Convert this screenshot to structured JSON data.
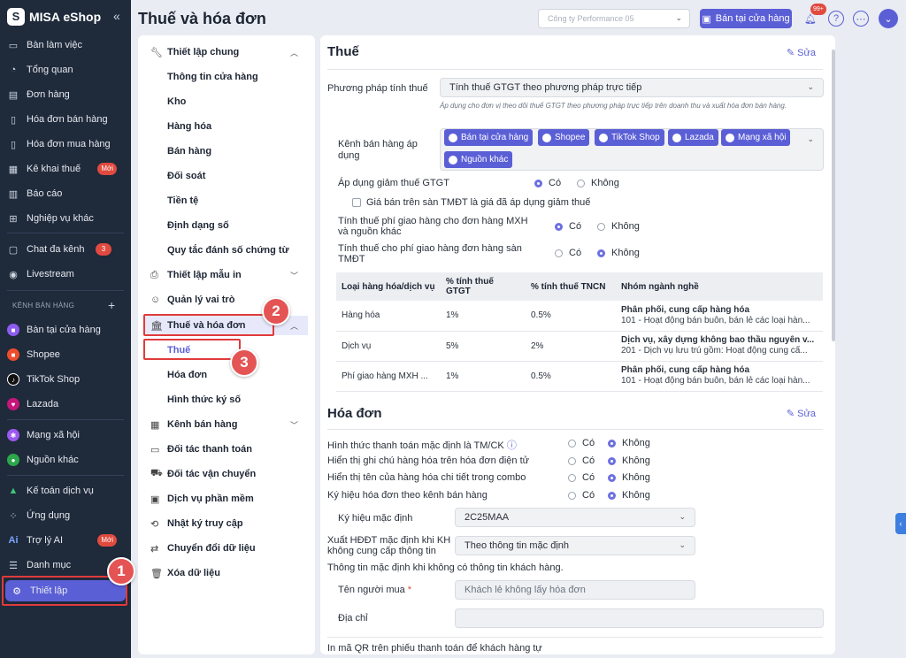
{
  "app": {
    "name": "MISA eShop",
    "page_title": "Thuế và hóa đơn",
    "company": "Công ty Performance 05"
  },
  "sidebar": {
    "items": [
      {
        "label": "Bàn làm việc",
        "icon": "monitor-icon"
      },
      {
        "label": "Tổng quan",
        "icon": "gauge-icon"
      },
      {
        "label": "Đơn hàng",
        "icon": "order-icon"
      },
      {
        "label": "Hóa đơn bán hàng",
        "icon": "invoice-icon"
      },
      {
        "label": "Hóa đơn mua hàng",
        "icon": "invoice-icon"
      },
      {
        "label": "Kê khai thuế",
        "icon": "tax-icon",
        "badge": "Mới"
      },
      {
        "label": "Báo cáo",
        "icon": "chart-icon"
      },
      {
        "label": "Nghiệp vụ khác",
        "icon": "grid-icon"
      }
    ],
    "items2": [
      {
        "label": "Chat đa kênh",
        "icon": "chat-icon",
        "badge": "3"
      },
      {
        "label": "Livestream",
        "icon": "live-icon"
      }
    ],
    "section_label": "KÊNH BÁN HÀNG",
    "channels": [
      {
        "label": "Bàn tại cửa hàng",
        "color": "#8e5cf0"
      },
      {
        "label": "Shopee",
        "color": "#ee4d2d"
      },
      {
        "label": "TikTok Shop",
        "color": "#111111"
      },
      {
        "label": "Lazada",
        "color": "#c7167a"
      }
    ],
    "channels2": [
      {
        "label": "Mạng xã hội",
        "color": "#9b59f0"
      },
      {
        "label": "Nguồn khác",
        "color": "#2aa84a"
      }
    ],
    "bottom": [
      {
        "label": "Kế toán dịch vụ",
        "icon": "accounting-icon"
      },
      {
        "label": "Ứng dụng",
        "icon": "apps-icon"
      },
      {
        "label": "Trợ lý AI",
        "icon": "ai-icon",
        "badge": "Mới"
      },
      {
        "label": "Danh mục",
        "icon": "list-icon"
      },
      {
        "label": "Thiết lập",
        "icon": "gear-icon"
      }
    ]
  },
  "topbar": {
    "sell_button": "Bán tại cửa hàng",
    "bell_badge": "99+"
  },
  "menu": {
    "general": "Thiết lập chung",
    "general_items": [
      "Thông tin cửa hàng",
      "Kho",
      "Hàng hóa",
      "Bán hàng",
      "Đối soát",
      "Tiền tệ",
      "Định dạng số",
      "Quy tắc đánh số chứng từ"
    ],
    "print": "Thiết lập mẫu in",
    "roles": "Quản lý vai trò",
    "tax": "Thuế và hóa đơn",
    "tax_items": [
      "Thuế",
      "Hóa đơn",
      "Hình thức ký số"
    ],
    "channels": "Kênh bán hàng",
    "payment": "Đối tác thanh toán",
    "shipping": "Đối tác vận chuyển",
    "software": "Dịch vụ phần mềm",
    "log": "Nhật ký truy cập",
    "convert": "Chuyển đổi dữ liệu",
    "delete": "Xóa dữ liệu"
  },
  "tax": {
    "title": "Thuế",
    "edit": "Sửa",
    "method_label": "Phương pháp tính thuế",
    "method_value": "Tính thuế GTGT theo phương pháp trực tiếp",
    "method_hint": "Áp dụng cho đơn vị theo dõi thuế GTGT theo phương pháp trực tiếp trên doanh thu và xuất hóa đơn bán hàng.",
    "channels_label": "Kênh bán hàng áp dụng",
    "channels": [
      "Bán tại cửa hàng",
      "Shopee",
      "TikTok Shop",
      "Lazada",
      "Mạng xã hội",
      "Nguồn khác"
    ],
    "vat_reduce_label": "Áp dụng giảm thuế GTGT",
    "yes": "Có",
    "no": "Không",
    "price_note": "Giá bán trên sàn TMĐT là giá đã áp dụng giảm thuế",
    "ship_mxh_label": "Tính thuế phí giao hàng cho đơn hàng MXH và nguồn khác",
    "ship_tmdt_label": "Tính thuế cho phí giao hàng đơn hàng sàn TMĐT",
    "table": {
      "headers": [
        "Loại hàng hóa/dịch vụ",
        "% tính thuế GTGT",
        "% tính thuế TNCN",
        "Nhóm ngành nghề"
      ],
      "rows": [
        {
          "type": "Hàng hóa",
          "vat": "1%",
          "pit": "0.5%",
          "group": "Phân phối, cung cấp hàng hóa",
          "desc": "101 - Hoạt động bán buôn, bán lẻ các loại hàn..."
        },
        {
          "type": "Dịch vụ",
          "vat": "5%",
          "pit": "2%",
          "group": "Dịch vụ, xây dựng không bao thầu nguyên v...",
          "desc": "201 - Dịch vụ lưu trú gồm: Hoạt động cung cấ..."
        },
        {
          "type": "Phí giao hàng MXH ...",
          "vat": "1%",
          "pit": "0.5%",
          "group": "Phân phối, cung cấp hàng hóa",
          "desc": "101 - Hoạt động bán buôn, bán lẻ các loại hàn..."
        }
      ]
    }
  },
  "invoice": {
    "title": "Hóa đơn",
    "edit": "Sửa",
    "opt1": "Hình thức thanh toán mặc định là TM/CK",
    "opt2": "Hiển thị ghi chú hàng hóa trên hóa đơn điện tử",
    "opt3": "Hiển thị tên của hàng hóa chi tiết trong combo",
    "opt4": "Ký hiệu hóa đơn theo kênh bán hàng",
    "symbol_label": "Ký hiệu mặc định",
    "symbol_value": "2C25MAA",
    "export_label": "Xuất HĐĐT mặc định khi KH không cung cấp thông tin",
    "export_value": "Theo thông tin mặc định",
    "default_info": "Thông tin mặc định khi không có thông tin khách hàng.",
    "buyer_label": "Tên người mua",
    "buyer_value": "Khách lẻ không lấy hóa đơn",
    "address_label": "Địa chỉ",
    "qr_label": "In mã QR trên phiếu thanh toán để khách hàng tự"
  },
  "markers": [
    "1",
    "2",
    "3"
  ]
}
